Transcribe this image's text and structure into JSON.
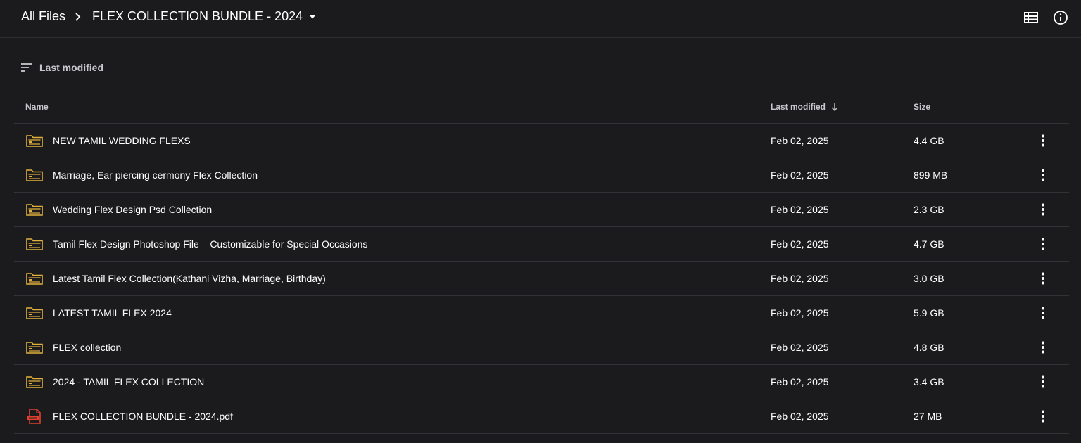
{
  "breadcrumb": {
    "root": "All Files",
    "current": "FLEX COLLECTION BUNDLE - 2024"
  },
  "toolbar": {
    "view_icon": "list-view-icon",
    "info_icon": "info-icon"
  },
  "sort": {
    "label": "Last modified",
    "icon": "sort-icon"
  },
  "columns": {
    "name": "Name",
    "modified": "Last modified",
    "size": "Size"
  },
  "colors": {
    "background": "#1b1b1d",
    "folder": "#e2b13c",
    "pdf": "#e0412f",
    "divider": "#333337"
  },
  "rows": [
    {
      "name": "NEW TAMIL WEDDING FLEXS",
      "modified": "Feb 02, 2025",
      "size": "4.4 GB",
      "type": "folder"
    },
    {
      "name": "Marriage, Ear piercing cermony Flex Collection",
      "modified": "Feb 02, 2025",
      "size": "899 MB",
      "type": "folder"
    },
    {
      "name": "Wedding Flex Design Psd Collection",
      "modified": "Feb 02, 2025",
      "size": "2.3 GB",
      "type": "folder"
    },
    {
      "name": "Tamil Flex Design Photoshop File – Customizable for Special Occasions",
      "modified": "Feb 02, 2025",
      "size": "4.7 GB",
      "type": "folder"
    },
    {
      "name": "Latest Tamil Flex Collection(Kathani Vizha, Marriage, Birthday)",
      "modified": "Feb 02, 2025",
      "size": "3.0 GB",
      "type": "folder"
    },
    {
      "name": "LATEST TAMIL FLEX 2024",
      "modified": "Feb 02, 2025",
      "size": "5.9 GB",
      "type": "folder"
    },
    {
      "name": "FLEX collection",
      "modified": "Feb 02, 2025",
      "size": "4.8 GB",
      "type": "folder"
    },
    {
      "name": "2024 - TAMIL FLEX COLLECTION",
      "modified": "Feb 02, 2025",
      "size": "3.4 GB",
      "type": "folder"
    },
    {
      "name": "FLEX COLLECTION BUNDLE - 2024.pdf",
      "modified": "Feb 02, 2025",
      "size": "27 MB",
      "type": "pdf"
    }
  ]
}
